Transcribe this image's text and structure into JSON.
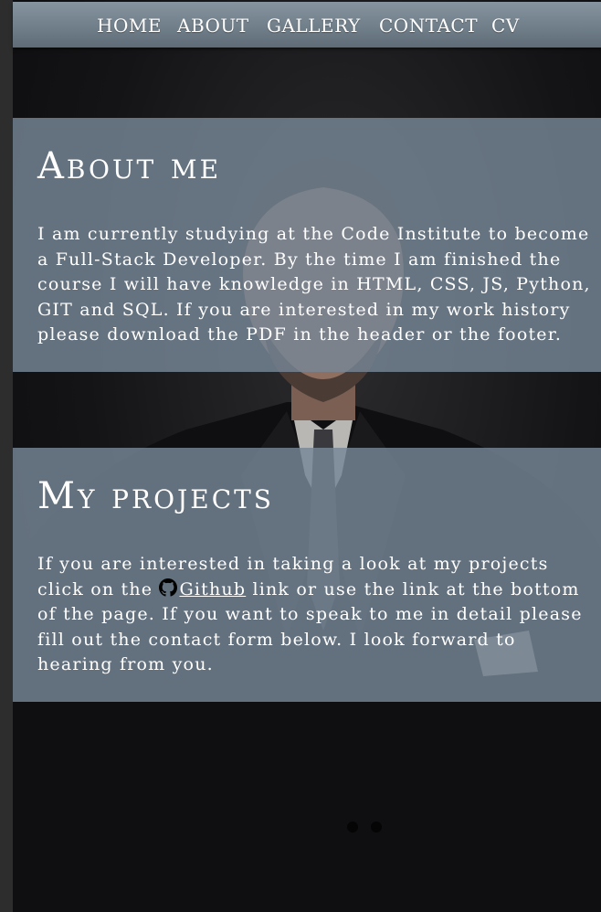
{
  "nav": {
    "items": [
      {
        "label": "HOME"
      },
      {
        "label": "ABOUT"
      },
      {
        "label": "GALLERY"
      },
      {
        "label": "CONTACT"
      },
      {
        "label": "CV"
      }
    ]
  },
  "about": {
    "title": "About me",
    "text": "I am currently studying at the Code Institute to become a Full-Stack Developer. By the time I am finished the course I will have knowledge in HTML, CSS, JS, Python, GIT and SQL. If you are interested in my work history please download the PDF in the header or the footer."
  },
  "projects": {
    "title": "My projects",
    "text_before": "If you are interested in taking a look at my projects click on the ",
    "link_label": "Github",
    "text_after": " link or use the link at the bottom of the page. If you want to speak to me in detail please fill out the contact form below. I look forward to hearing from you."
  },
  "icons": {
    "github": "github-icon"
  },
  "colors": {
    "navbar": "#6f7d88",
    "panel": "#768696",
    "text": "#ffffff",
    "background": "#141416"
  }
}
